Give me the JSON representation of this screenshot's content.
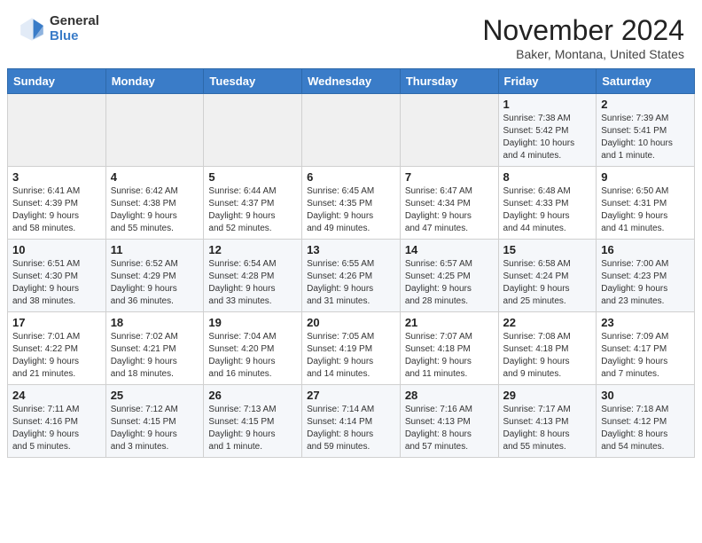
{
  "header": {
    "logo": {
      "general": "General",
      "blue": "Blue"
    },
    "month": "November 2024",
    "location": "Baker, Montana, United States"
  },
  "weekdays": [
    "Sunday",
    "Monday",
    "Tuesday",
    "Wednesday",
    "Thursday",
    "Friday",
    "Saturday"
  ],
  "weeks": [
    [
      {
        "day": "",
        "info": ""
      },
      {
        "day": "",
        "info": ""
      },
      {
        "day": "",
        "info": ""
      },
      {
        "day": "",
        "info": ""
      },
      {
        "day": "",
        "info": ""
      },
      {
        "day": "1",
        "info": "Sunrise: 7:38 AM\nSunset: 5:42 PM\nDaylight: 10 hours\nand 4 minutes."
      },
      {
        "day": "2",
        "info": "Sunrise: 7:39 AM\nSunset: 5:41 PM\nDaylight: 10 hours\nand 1 minute."
      }
    ],
    [
      {
        "day": "3",
        "info": "Sunrise: 6:41 AM\nSunset: 4:39 PM\nDaylight: 9 hours\nand 58 minutes."
      },
      {
        "day": "4",
        "info": "Sunrise: 6:42 AM\nSunset: 4:38 PM\nDaylight: 9 hours\nand 55 minutes."
      },
      {
        "day": "5",
        "info": "Sunrise: 6:44 AM\nSunset: 4:37 PM\nDaylight: 9 hours\nand 52 minutes."
      },
      {
        "day": "6",
        "info": "Sunrise: 6:45 AM\nSunset: 4:35 PM\nDaylight: 9 hours\nand 49 minutes."
      },
      {
        "day": "7",
        "info": "Sunrise: 6:47 AM\nSunset: 4:34 PM\nDaylight: 9 hours\nand 47 minutes."
      },
      {
        "day": "8",
        "info": "Sunrise: 6:48 AM\nSunset: 4:33 PM\nDaylight: 9 hours\nand 44 minutes."
      },
      {
        "day": "9",
        "info": "Sunrise: 6:50 AM\nSunset: 4:31 PM\nDaylight: 9 hours\nand 41 minutes."
      }
    ],
    [
      {
        "day": "10",
        "info": "Sunrise: 6:51 AM\nSunset: 4:30 PM\nDaylight: 9 hours\nand 38 minutes."
      },
      {
        "day": "11",
        "info": "Sunrise: 6:52 AM\nSunset: 4:29 PM\nDaylight: 9 hours\nand 36 minutes."
      },
      {
        "day": "12",
        "info": "Sunrise: 6:54 AM\nSunset: 4:28 PM\nDaylight: 9 hours\nand 33 minutes."
      },
      {
        "day": "13",
        "info": "Sunrise: 6:55 AM\nSunset: 4:26 PM\nDaylight: 9 hours\nand 31 minutes."
      },
      {
        "day": "14",
        "info": "Sunrise: 6:57 AM\nSunset: 4:25 PM\nDaylight: 9 hours\nand 28 minutes."
      },
      {
        "day": "15",
        "info": "Sunrise: 6:58 AM\nSunset: 4:24 PM\nDaylight: 9 hours\nand 25 minutes."
      },
      {
        "day": "16",
        "info": "Sunrise: 7:00 AM\nSunset: 4:23 PM\nDaylight: 9 hours\nand 23 minutes."
      }
    ],
    [
      {
        "day": "17",
        "info": "Sunrise: 7:01 AM\nSunset: 4:22 PM\nDaylight: 9 hours\nand 21 minutes."
      },
      {
        "day": "18",
        "info": "Sunrise: 7:02 AM\nSunset: 4:21 PM\nDaylight: 9 hours\nand 18 minutes."
      },
      {
        "day": "19",
        "info": "Sunrise: 7:04 AM\nSunset: 4:20 PM\nDaylight: 9 hours\nand 16 minutes."
      },
      {
        "day": "20",
        "info": "Sunrise: 7:05 AM\nSunset: 4:19 PM\nDaylight: 9 hours\nand 14 minutes."
      },
      {
        "day": "21",
        "info": "Sunrise: 7:07 AM\nSunset: 4:18 PM\nDaylight: 9 hours\nand 11 minutes."
      },
      {
        "day": "22",
        "info": "Sunrise: 7:08 AM\nSunset: 4:18 PM\nDaylight: 9 hours\nand 9 minutes."
      },
      {
        "day": "23",
        "info": "Sunrise: 7:09 AM\nSunset: 4:17 PM\nDaylight: 9 hours\nand 7 minutes."
      }
    ],
    [
      {
        "day": "24",
        "info": "Sunrise: 7:11 AM\nSunset: 4:16 PM\nDaylight: 9 hours\nand 5 minutes."
      },
      {
        "day": "25",
        "info": "Sunrise: 7:12 AM\nSunset: 4:15 PM\nDaylight: 9 hours\nand 3 minutes."
      },
      {
        "day": "26",
        "info": "Sunrise: 7:13 AM\nSunset: 4:15 PM\nDaylight: 9 hours\nand 1 minute."
      },
      {
        "day": "27",
        "info": "Sunrise: 7:14 AM\nSunset: 4:14 PM\nDaylight: 8 hours\nand 59 minutes."
      },
      {
        "day": "28",
        "info": "Sunrise: 7:16 AM\nSunset: 4:13 PM\nDaylight: 8 hours\nand 57 minutes."
      },
      {
        "day": "29",
        "info": "Sunrise: 7:17 AM\nSunset: 4:13 PM\nDaylight: 8 hours\nand 55 minutes."
      },
      {
        "day": "30",
        "info": "Sunrise: 7:18 AM\nSunset: 4:12 PM\nDaylight: 8 hours\nand 54 minutes."
      }
    ]
  ]
}
